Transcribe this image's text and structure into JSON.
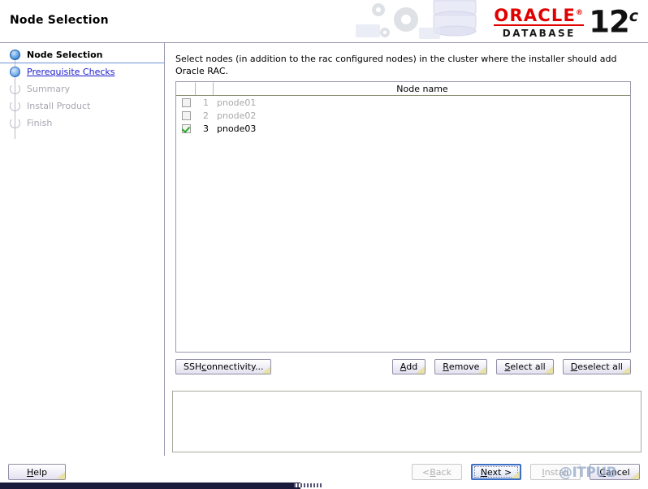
{
  "header": {
    "title": "Node Selection",
    "logo": {
      "oracle": "ORACLE",
      "registered": "®",
      "database": "DATABASE",
      "version_number": "12",
      "version_suffix": "c"
    }
  },
  "sidebar": {
    "items": [
      {
        "label": "Node Selection",
        "state": "current"
      },
      {
        "label": "Prerequisite Checks",
        "state": "done"
      },
      {
        "label": "Summary",
        "state": "pending"
      },
      {
        "label": "Install Product",
        "state": "pending"
      },
      {
        "label": "Finish",
        "state": "pending"
      }
    ]
  },
  "main": {
    "instruction": "Select nodes (in addition to the rac configured nodes) in the cluster where the installer should add Oracle RAC.",
    "table": {
      "headers": {
        "check": "",
        "index": "",
        "name": "Node name"
      },
      "rows": [
        {
          "index": "1",
          "name": "pnode01",
          "checked": false,
          "enabled": false
        },
        {
          "index": "2",
          "name": "pnode02",
          "checked": false,
          "enabled": false
        },
        {
          "index": "3",
          "name": "pnode03",
          "checked": true,
          "enabled": true
        }
      ]
    },
    "buttons": {
      "ssh_connectivity": {
        "pre": "SSH ",
        "mnemonic": "c",
        "post": "onnectivity..."
      },
      "add": {
        "pre": "",
        "mnemonic": "A",
        "post": "dd"
      },
      "remove": {
        "pre": "",
        "mnemonic": "R",
        "post": "emove"
      },
      "select_all": {
        "pre": "",
        "mnemonic": "S",
        "post": "elect all"
      },
      "deselect_all": {
        "pre": "",
        "mnemonic": "D",
        "post": "eselect all"
      }
    },
    "message_panel": {
      "text": ""
    }
  },
  "footer": {
    "help": {
      "pre": "",
      "mnemonic": "H",
      "post": "elp"
    },
    "back": {
      "pre": "< ",
      "mnemonic": "B",
      "post": "ack",
      "disabled": true
    },
    "next": {
      "pre": "",
      "mnemonic": "N",
      "post": "ext >",
      "focused": true
    },
    "install": {
      "pre": "",
      "mnemonic": "I",
      "post": "nstall",
      "disabled": true
    },
    "cancel": {
      "pre": "",
      "mnemonic": "C",
      "post": "ancel"
    }
  },
  "watermark": {
    "text": "@ITPUB"
  },
  "colors": {
    "oracle_red": "#e00000",
    "check_green": "#2aa82a",
    "link_blue": "#1a1acc",
    "focus_blue": "#3b6fc4",
    "bottom_bar": "#1a1a3c"
  }
}
